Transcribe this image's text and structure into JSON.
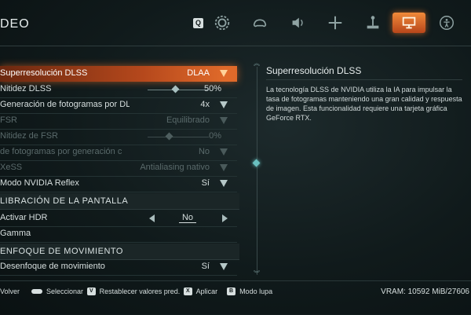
{
  "header": {
    "title": "DEO",
    "tab_switch_key": "Q",
    "tabs": [
      {
        "icon": "gear-icon",
        "active": false
      },
      {
        "icon": "controller-icon",
        "active": false
      },
      {
        "icon": "speaker-icon",
        "active": false
      },
      {
        "icon": "crosshair-icon",
        "active": false
      },
      {
        "icon": "joystick-icon",
        "active": false
      },
      {
        "icon": "monitor-icon",
        "active": true
      },
      {
        "icon": "accessibility-icon",
        "active": false
      }
    ]
  },
  "settings": {
    "rows": [
      {
        "label": "Superresolución DLSS",
        "value": "DLAA",
        "control": "dropdown",
        "selected": true
      },
      {
        "label": "Nitidez DLSS",
        "value": "50%",
        "control": "slider",
        "level": 0.45
      },
      {
        "label": "Generación de fotogramas por DL",
        "value": "4x",
        "control": "dropdown"
      },
      {
        "label": "FSR",
        "value": "Equilibrado",
        "control": "dropdown",
        "disabled": true
      },
      {
        "label": "Nitidez de FSR",
        "value": "0%",
        "control": "slider",
        "level": 0.35,
        "disabled": true
      },
      {
        "label": "de fotogramas por generación c",
        "value": "No",
        "control": "dropdown",
        "disabled": true
      },
      {
        "label": "XeSS",
        "value": "Antialiasing nativo",
        "control": "dropdown",
        "disabled": true
      },
      {
        "label": "Modo NVIDIA Reflex",
        "value": "Sí",
        "control": "dropdown"
      }
    ],
    "section_calibration": "LIBRACIÓN DE LA PANTALLA",
    "hdr": {
      "label": "Activar HDR",
      "value": "No"
    },
    "gamma": {
      "label": "Gamma"
    },
    "section_blur": "ENFOQUE DE MOVIMIENTO",
    "blur": {
      "label": "Desenfoque de movimiento",
      "value": "Sí"
    }
  },
  "description": {
    "title": "Superresolución DLSS",
    "text": "La tecnología DLSS de NVIDIA utiliza la IA para impulsar la tasa de fotogramas manteniendo una gran calidad y respuesta de imagen. Esta funcionalidad requiere una tarjeta gráfica GeForce RTX."
  },
  "footer": {
    "back": {
      "key": "",
      "label": "Volver"
    },
    "select": {
      "key": "",
      "label": "Seleccionar"
    },
    "reset": {
      "key": "V",
      "label": "Restablecer valores pred."
    },
    "apply": {
      "key": "X",
      "label": "Aplicar"
    },
    "magnifier": {
      "key": "B",
      "label": "Modo lupa"
    },
    "vram": "VRAM: 10592 MiB/27606"
  },
  "colors": {
    "accent": "#e06a2a",
    "highlight": "#6ac0c0"
  }
}
